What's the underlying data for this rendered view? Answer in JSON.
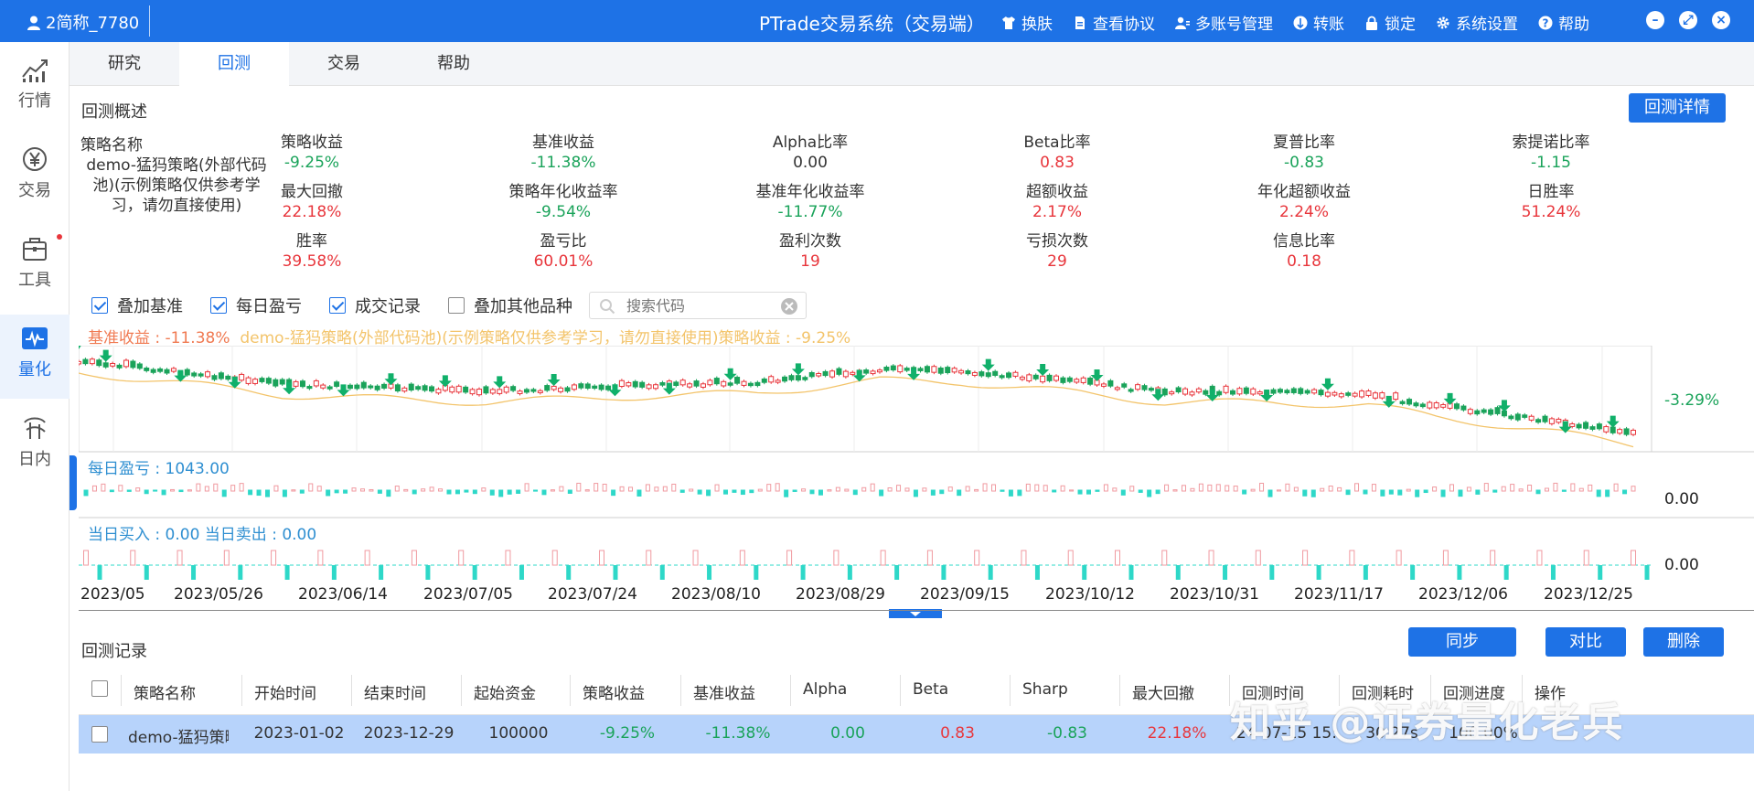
{
  "titlebar": {
    "user": "2简称_7780",
    "app_title": "PTrade交易系统（交易端）",
    "menu": [
      {
        "label": "换肤",
        "icon": "shirt-icon"
      },
      {
        "label": "查看协议",
        "icon": "document-icon"
      },
      {
        "label": "多账号管理",
        "icon": "users-icon"
      },
      {
        "label": "转账",
        "icon": "transfer-icon"
      },
      {
        "label": "锁定",
        "icon": "lock-icon"
      },
      {
        "label": "系统设置",
        "icon": "gear-icon"
      },
      {
        "label": "帮助",
        "icon": "help-icon"
      }
    ]
  },
  "sidebar": {
    "items": [
      {
        "label": "行情",
        "icon": "market-chart-icon"
      },
      {
        "label": "交易",
        "icon": "yen-coin-icon"
      },
      {
        "label": "工具",
        "icon": "toolbox-icon"
      },
      {
        "label": "量化",
        "icon": "quant-icon"
      },
      {
        "label": "日内",
        "icon": "intraday-icon"
      }
    ]
  },
  "tabs": [
    "研究",
    "回测",
    "交易",
    "帮助"
  ],
  "overview": {
    "title": "回测概述",
    "detail_button": "回测详情",
    "strategy_label": "策略名称",
    "strategy_name": "demo-猛犸策略(外部代码池)(示例策略仅供参考学习，请勿直接使用)",
    "metrics": [
      {
        "label": "策略收益",
        "value": "-9.25%",
        "color": "green"
      },
      {
        "label": "基准收益",
        "value": "-11.38%",
        "color": "green"
      },
      {
        "label": "Alpha比率",
        "value": "0.00",
        "color": "dark"
      },
      {
        "label": "Beta比率",
        "value": "0.83",
        "color": "red"
      },
      {
        "label": "夏普比率",
        "value": "-0.83",
        "color": "green"
      },
      {
        "label": "索提诺比率",
        "value": "-1.15",
        "color": "green"
      },
      {
        "label": "最大回撤",
        "value": "22.18%",
        "color": "red"
      },
      {
        "label": "策略年化收益率",
        "value": "-9.54%",
        "color": "green"
      },
      {
        "label": "基准年化收益率",
        "value": "-11.77%",
        "color": "green"
      },
      {
        "label": "超额收益",
        "value": "2.17%",
        "color": "red"
      },
      {
        "label": "年化超额收益",
        "value": "2.24%",
        "color": "red"
      },
      {
        "label": "日胜率",
        "value": "51.24%",
        "color": "red"
      },
      {
        "label": "胜率",
        "value": "39.58%",
        "color": "red"
      },
      {
        "label": "盈亏比",
        "value": "60.01%",
        "color": "red"
      },
      {
        "label": "盈利次数",
        "value": "19",
        "color": "red"
      },
      {
        "label": "亏损次数",
        "value": "29",
        "color": "red"
      },
      {
        "label": "信息比率",
        "value": "0.18",
        "color": "red"
      }
    ]
  },
  "options": [
    {
      "label": "叠加基准",
      "checked": true
    },
    {
      "label": "每日盈亏",
      "checked": true
    },
    {
      "label": "成交记录",
      "checked": true
    },
    {
      "label": "叠加其他品种",
      "checked": false
    }
  ],
  "search": {
    "placeholder": "搜索代码"
  },
  "chart_data": {
    "type": "line",
    "benchmark_legend": "基准收益 : -11.38%",
    "strategy_legend": "demo-猛犸策略(外部代码池)(示例策略仅供参考学习，请勿直接使用)策略收益 : -9.25%",
    "current_return_label": "-3.29%",
    "daily_pnl_label": "每日盈亏 : 1043.00",
    "daily_pnl_value": "0.00",
    "trade_label": "当日买入 : 0.00  当日卖出 : 0.00",
    "trade_value": "0.00",
    "x_ticks": [
      "2023/05",
      "2023/05/26",
      "2023/06/14",
      "2023/07/05",
      "2023/07/24",
      "2023/08/10",
      "2023/08/29",
      "2023/09/15",
      "2023/10/12",
      "2023/10/31",
      "2023/11/17",
      "2023/12/06",
      "2023/12/25"
    ],
    "colors": {
      "benchmark": "#f3c46b",
      "candle_up": "#e8363c",
      "candle_down": "#1aa35a",
      "arrow": "#10b06a",
      "bar_pos": "#f09aa0",
      "bar_neg": "#2ed8c8"
    }
  },
  "records": {
    "title": "回测记录",
    "buttons": [
      "同步",
      "对比",
      "删除"
    ],
    "columns": [
      "策略名称",
      "开始时间",
      "结束时间",
      "起始资金",
      "策略收益",
      "基准收益",
      "Alpha",
      "Beta",
      "Sharp",
      "最大回撤",
      "回测时间",
      "回测耗时",
      "回测进度",
      "操作"
    ],
    "rows": [
      [
        "demo-猛犸策略",
        "2023-01-02",
        "2023-12-29",
        "100000",
        "-9.25%",
        "-11.38%",
        "0.00",
        "0.83",
        "-0.83",
        "22.18%",
        "24-07-15 15:",
        "30.27s",
        "100.00%",
        ""
      ]
    ]
  },
  "watermark": "知乎 @证券量化老兵"
}
